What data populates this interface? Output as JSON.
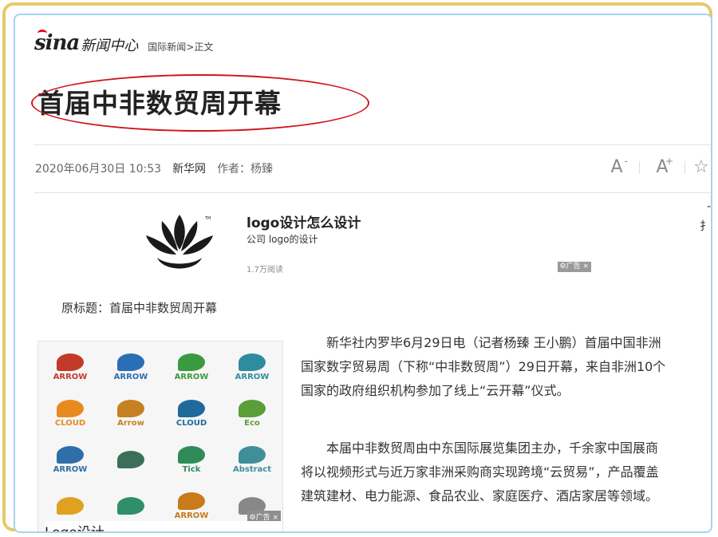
{
  "header": {
    "logo_text": "sina",
    "section_name": "新闻中心",
    "breadcrumb": {
      "category": "国际新闻",
      "separator": ">",
      "current": "正文"
    }
  },
  "article": {
    "title": "首届中非数贸周开幕",
    "datetime": "2020年06月30日 10:53",
    "source": "新华网",
    "author": "作者：杨臻",
    "original_title": "原标题：首届中非数贸周开幕",
    "paragraphs": [
      "新华社内罗毕6月29日电（记者杨臻 王小鹏）首届中国非洲国家数字贸易周（下称“中非数贸周”）29日开幕，来自非洲10个国家的政府组织机构参加了线上“云开幕”仪式。",
      "本届中非数贸周由中东国际展览集团主办，千余家中国展商将以视频形式与近万家非洲采购商实现跨境“云贸易”，产品覆盖建筑建材、电力能源、食品农业、家庭医疗、酒店家居等领域。"
    ]
  },
  "font_tools": {
    "decrease_label": "A",
    "decrease_sign": "-",
    "increase_label": "A",
    "increase_sign": "+",
    "star_icon": "☆"
  },
  "right_edge_glyphs": [
    "-",
    "扌"
  ],
  "top_ad": {
    "title": "logo设计怎么设计",
    "subtitle": "公司 logo的设计",
    "reads": "1.7万阅读",
    "badge": "⚙广告 ×"
  },
  "image_ad": {
    "caption": "Logo设计",
    "badge": "⚙广告 ×",
    "tiles": [
      {
        "text": "ARROW",
        "color": "#c43a2a"
      },
      {
        "text": "ARROW",
        "color": "#2a6fb5"
      },
      {
        "text": "ARROW",
        "color": "#3a9a3f"
      },
      {
        "text": "ARROW",
        "color": "#2e8c9e"
      },
      {
        "text": "CLOUD",
        "color": "#e98a1f"
      },
      {
        "text": "Arrow",
        "color": "#c7801f"
      },
      {
        "text": "CLOUD",
        "color": "#1e6a9c"
      },
      {
        "text": "Eco",
        "color": "#5a9e3a"
      },
      {
        "text": "ARROW",
        "color": "#2f6fa8"
      },
      {
        "text": "",
        "color": "#3c6f5a"
      },
      {
        "text": "Tick",
        "color": "#2f8c5a"
      },
      {
        "text": "Abstract",
        "color": "#3f8f9a"
      },
      {
        "text": "",
        "color": "#e0a020"
      },
      {
        "text": "",
        "color": "#2f8f6a"
      },
      {
        "text": "ARROW",
        "color": "#c97a1a"
      },
      {
        "text": "",
        "color": "#888888"
      }
    ]
  },
  "colors": {
    "frame_gold": "#e7c86a",
    "frame_blue": "#a9d3ec",
    "annotation_red": "#d0151b",
    "sina_red": "#e60012"
  }
}
